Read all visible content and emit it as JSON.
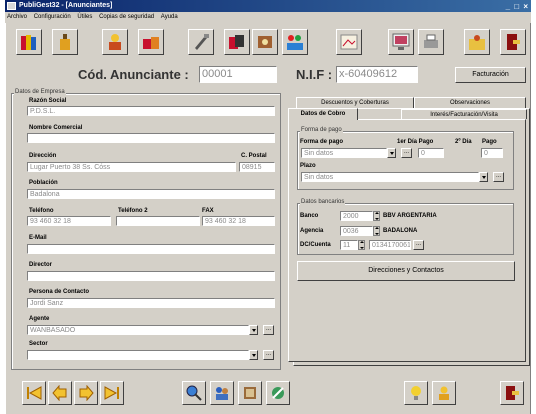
{
  "window": {
    "title": "PubliGest32 - [Anunciantes]",
    "controls": "_ □ ×"
  },
  "menu": [
    "Archivo",
    "Configuración",
    "Útiles",
    "Copias de seguridad",
    "Ayuda"
  ],
  "header": {
    "cod_label": "Cód. Anunciante :",
    "cod_value": "00001",
    "nif_label": "N.I.F :",
    "nif_value": "x-60409612",
    "facturacion_button": "Facturación"
  },
  "empresa": {
    "group_title": "Datos de Empresa",
    "razon_social_label": "Razón Social",
    "razon_social_value": "P.D.S.L.",
    "nombre_comercial_label": "Nombre Comercial",
    "nombre_comercial_value": "",
    "direccion_label": "Dirección",
    "direccion_value": "Lugar Puerto 38 Ss. Cóss",
    "cpostal_label": "C. Postal",
    "cpostal_value": "08915",
    "poblacion_label": "Población",
    "poblacion_value": "Badalona",
    "telefono_label": "Teléfono",
    "telefono_value": "93 460 32 18",
    "telefono2_label": "Teléfono 2",
    "telefono2_value": "",
    "fax_label": "FAX",
    "fax_value": "93 460 32 18",
    "email_label": "E-Mail",
    "email_value": "",
    "director_label": "Director",
    "director_value": "",
    "persona_label": "Persona de Contacto",
    "persona_value": "Jordi Sanz",
    "agente_label": "Agente",
    "agente_value": "WANBASADO",
    "sector_label": "Sector",
    "sector_value": ""
  },
  "tabs": {
    "descuentos": "Descuentos y Coberturas",
    "observaciones": "Observaciones",
    "cobro": "Datos de Cobro",
    "interes": "Interés/Facturación/Visita"
  },
  "cobro": {
    "forma_pago_group": "Forma de pago",
    "forma_pago_label": "Forma de pago",
    "forma_pago_value": "Sin datos",
    "primer_dia_label": "1er Día Pago",
    "primer_dia_value": "0",
    "segundo_dia_label": "2º Día",
    "pago_label": "Pago",
    "pago_value": "0",
    "plazo_label": "Plazo",
    "plazo_value": "Sin datos",
    "banco_group": "Datos bancarios",
    "banco_label": "Banco",
    "banco_value": "2000",
    "banco_name": "BBV ARGENTARIA",
    "agencia_label": "Agencia",
    "agencia_value": "0036",
    "agencia_name": "BADALONA",
    "dc_label": "DC/Cuenta",
    "dc_value": "11",
    "cuenta_value": "0134170061",
    "direcciones_button": "Direcciones y Contactos"
  },
  "icons": {
    "toolbar": [
      "books-icon",
      "bottle-icon",
      "person-icon",
      "gifts-icon",
      "tools-icon",
      "cards-icon",
      "puzzle-icon",
      "paint-icon",
      "picture-icon",
      "monitor-icon",
      "printer-icon",
      "person-folder-icon",
      "exit-door-icon"
    ],
    "bottom": [
      "first-icon",
      "prev-icon",
      "next-icon",
      "last-icon",
      "search-icon",
      "people-icon",
      "book-icon",
      "settings-icon",
      "bulb-icon",
      "person-gold-icon",
      "exit-door-icon"
    ]
  },
  "colors": {
    "face": "#d4d0c8",
    "title_start": "#0a246a",
    "title_end": "#3a6ea5",
    "arrow_yellow": "#f2c230"
  }
}
